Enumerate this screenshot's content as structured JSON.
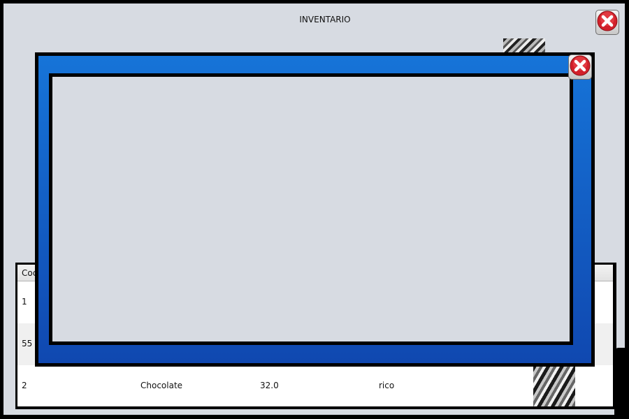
{
  "window": {
    "title": "INVENTARIO",
    "close_icon": "close-x-icon"
  },
  "table": {
    "columns": [
      "Coc"
    ],
    "rows": [
      {
        "code": "1",
        "name": "",
        "price": "",
        "description": ""
      },
      {
        "code": "55",
        "name": "",
        "price": "",
        "description": ""
      },
      {
        "code": "2",
        "name": "Chocolate",
        "price": "32.0",
        "description": "rico"
      }
    ]
  },
  "dialog": {
    "close_icon": "close-x-icon"
  },
  "colors": {
    "window_bg": "#d7dbe2",
    "dialog_frame_top": "#1674d8",
    "dialog_frame_bottom": "#1048b0",
    "close_red": "#d2202a"
  }
}
